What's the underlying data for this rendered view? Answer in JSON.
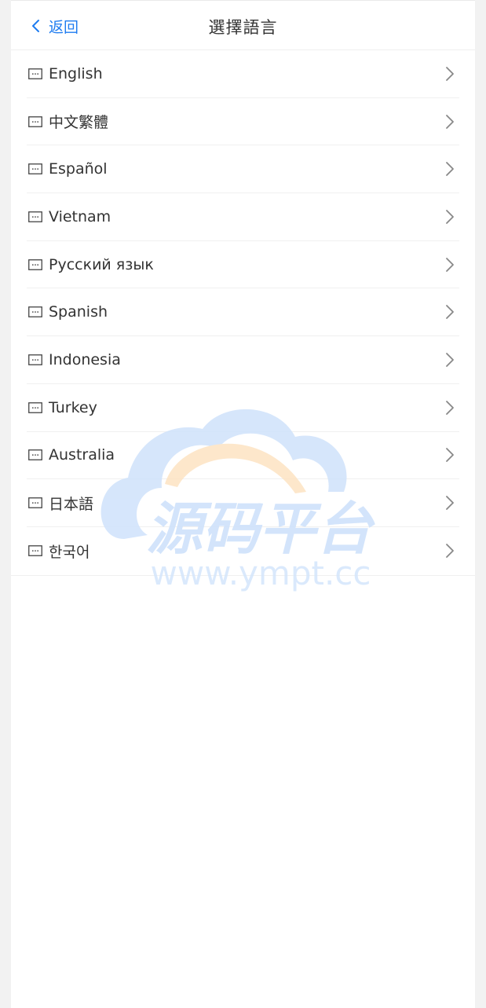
{
  "header": {
    "back_label": "返回",
    "title": "選擇語言"
  },
  "languages": [
    {
      "label": "English"
    },
    {
      "label": "中文繁體"
    },
    {
      "label": "Español"
    },
    {
      "label": "Vietnam"
    },
    {
      "label": "Русский язык"
    },
    {
      "label": "Spanish"
    },
    {
      "label": "Indonesia"
    },
    {
      "label": "Turkey"
    },
    {
      "label": "Australia"
    },
    {
      "label": "日本語"
    },
    {
      "label": "한국어"
    }
  ],
  "watermark": {
    "logo_text": "源码平台",
    "url_text": "www.ympt.cc"
  },
  "colors": {
    "accent": "#1e7cf0",
    "text": "#333333",
    "divider": "#f0f0f0",
    "watermark_blue": "#cfe2fb",
    "watermark_orange": "#fde3c2"
  },
  "icons": {
    "back": "chevron-left-icon",
    "row_leading": "keyboard-icon",
    "row_trailing": "chevron-right-icon"
  }
}
